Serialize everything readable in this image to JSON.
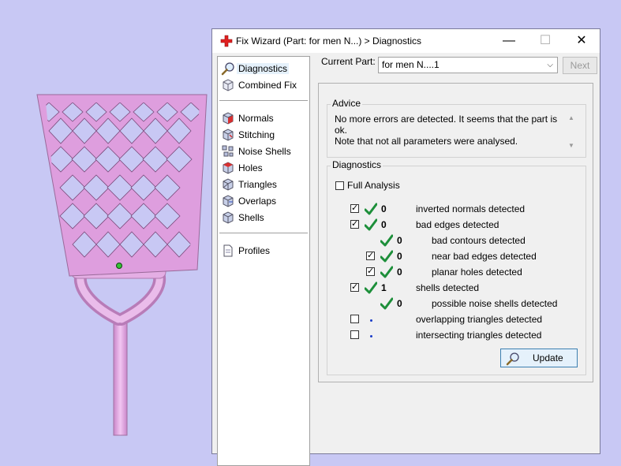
{
  "window": {
    "title": "Fix Wizard (Part: for men N...) > Diagnostics",
    "minimize_glyph": "—",
    "maximize_glyph": "☐",
    "close_glyph": "✕"
  },
  "sidebar": {
    "group1": [
      {
        "label": "Diagnostics",
        "icon": "magnifier-icon",
        "selected": true
      },
      {
        "label": "Combined Fix",
        "icon": "cube-icon"
      }
    ],
    "group2": [
      {
        "label": "Normals",
        "icon": "normals-cube-icon"
      },
      {
        "label": "Stitching",
        "icon": "stitching-cube-icon"
      },
      {
        "label": "Noise Shells",
        "icon": "noise-shells-icon"
      },
      {
        "label": "Holes",
        "icon": "holes-cube-icon"
      },
      {
        "label": "Triangles",
        "icon": "triangles-cube-icon"
      },
      {
        "label": "Overlaps",
        "icon": "overlaps-cube-icon"
      },
      {
        "label": "Shells",
        "icon": "shells-cube-icon"
      }
    ],
    "group3": [
      {
        "label": "Profiles",
        "icon": "document-icon"
      }
    ]
  },
  "current_part": {
    "label": "Current Part:",
    "value": "for men N....1",
    "next_label": "Next"
  },
  "advice": {
    "title": "Advice",
    "line1": "No more errors are detected. It seems that the part is ok.",
    "line2": "Note that not all parameters were analysed."
  },
  "diagnostics": {
    "title": "Diagnostics",
    "full_analysis_label": "Full Analysis",
    "full_analysis_checked": false,
    "rows": [
      {
        "checkbox": "checked",
        "status": "ok",
        "count": "0",
        "label": "inverted normals detected"
      },
      {
        "checkbox": "checked",
        "status": "ok",
        "count": "0",
        "label": "bad edges detected"
      },
      {
        "checkbox": "none",
        "status": "ok",
        "count": "0",
        "label": "bad contours detected"
      },
      {
        "checkbox": "checked",
        "status": "ok",
        "count": "0",
        "label": "near bad edges detected"
      },
      {
        "checkbox": "checked",
        "status": "ok",
        "count": "0",
        "label": "planar holes detected"
      },
      {
        "checkbox": "checked",
        "status": "ok",
        "count": "1",
        "label": "shells detected"
      },
      {
        "checkbox": "none",
        "status": "ok",
        "count": "0",
        "label": "possible noise shells detected"
      },
      {
        "checkbox": "unchecked",
        "status": "pending",
        "count": "",
        "label": "overlapping triangles detected"
      },
      {
        "checkbox": "unchecked",
        "status": "pending",
        "count": "",
        "label": "intersecting triangles detected"
      }
    ],
    "update_label": "Update"
  },
  "colors": {
    "background": "#c8c8f4",
    "model": "#e8b0e8",
    "check_green": "#1d8f3a",
    "accent_blue": "#3c7fb1"
  }
}
